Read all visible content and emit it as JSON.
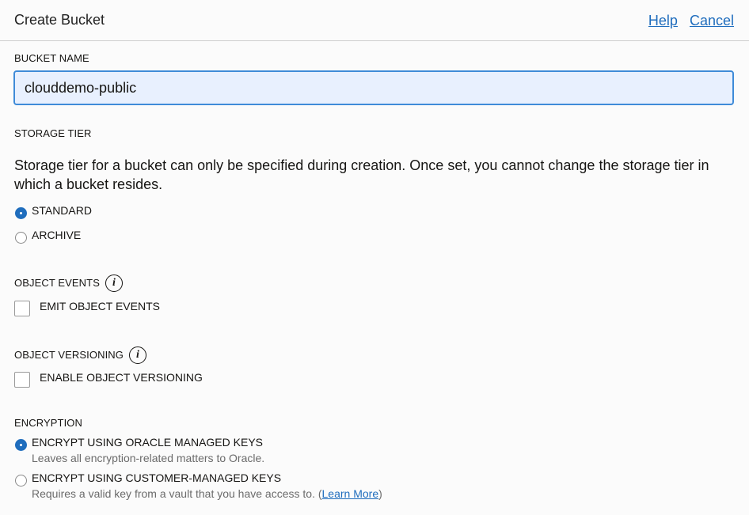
{
  "header": {
    "title": "Create Bucket",
    "help": "Help",
    "cancel": "Cancel"
  },
  "bucket_name": {
    "label": "BUCKET NAME",
    "value": "clouddemo-public"
  },
  "storage_tier": {
    "label": "STORAGE TIER",
    "description": "Storage tier for a bucket can only be specified during creation. Once set, you cannot change the storage tier in which a bucket resides.",
    "options": [
      {
        "label": "STANDARD",
        "selected": true
      },
      {
        "label": "ARCHIVE",
        "selected": false
      }
    ]
  },
  "object_events": {
    "label": "OBJECT EVENTS",
    "checkbox_label": "EMIT OBJECT EVENTS",
    "checked": false,
    "info_icon": "info-icon"
  },
  "object_versioning": {
    "label": "OBJECT VERSIONING",
    "checkbox_label": "ENABLE OBJECT VERSIONING",
    "checked": false,
    "info_icon": "info-icon"
  },
  "encryption": {
    "label": "ENCRYPTION",
    "options": [
      {
        "label": "ENCRYPT USING ORACLE MANAGED KEYS",
        "sub": "Leaves all encryption-related matters to Oracle.",
        "selected": true
      },
      {
        "label": "ENCRYPT USING CUSTOMER-MANAGED KEYS",
        "sub_prefix": "Requires a valid key from a vault that you have access to. (",
        "learn_more": "Learn More",
        "sub_suffix": ")",
        "selected": false
      }
    ]
  },
  "colors": {
    "accent": "#1f6dbd",
    "input_bg": "#e8f0fe",
    "input_border": "#3f8bd8"
  }
}
